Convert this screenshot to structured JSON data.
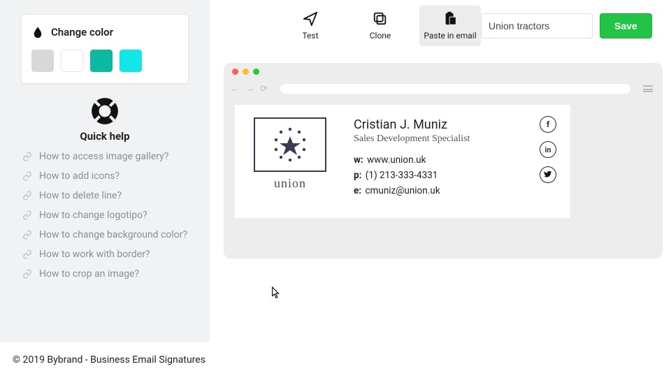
{
  "sidebar": {
    "color_panel_title": "Change color",
    "quick_help_title": "Quick help",
    "help_items": [
      "How to access image gallery?",
      "How to add icons?",
      "How to delete line?",
      "How to change logotipo?",
      "How to change background color?",
      "How to work with border?",
      "How to crop an image?"
    ]
  },
  "toolbar": {
    "test": "Test",
    "clone": "Clone",
    "paste": "Paste in email",
    "name_value": "Union tractors",
    "save": "Save"
  },
  "signature": {
    "logo_text": "union",
    "name": "Cristian J. Muniz",
    "role": "Sales Development Specialist",
    "web_label": "w:",
    "web": "www.union.uk",
    "phone_label": "p:",
    "phone": "(1) 213-333-4331",
    "email_label": "e:",
    "email": "cmuniz@union.uk",
    "fb": "f",
    "in": "in"
  },
  "footer": "© 2019 Bybrand - Business Email Signatures"
}
